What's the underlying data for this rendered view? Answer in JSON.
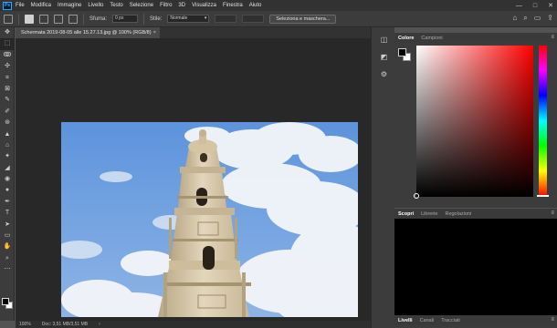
{
  "app": {
    "logo_text": "Ps"
  },
  "menu": [
    "File",
    "Modifica",
    "Immagine",
    "Livello",
    "Testo",
    "Selezione",
    "Filtro",
    "3D",
    "Visualizza",
    "Finestra",
    "Aiuto"
  ],
  "window_controls": [
    "—",
    "□",
    "✕"
  ],
  "options_bar": {
    "feather_label": "Sfuma:",
    "feather_value": "0 px",
    "style_label": "Stile:",
    "style_value": "Normale",
    "select_mask_button": "Seleziona e maschera...",
    "right_icons": [
      "⌂",
      "⌕",
      "▭",
      "⇪"
    ]
  },
  "tools": [
    "✥",
    "⬚",
    "ↂ",
    "✣",
    "⌗",
    "⊠",
    "✎",
    "✐",
    "⊛",
    "▲",
    "⌂",
    "✦",
    "◢",
    "◉",
    "●",
    "✒",
    "T",
    "➤",
    "▭",
    "✋",
    "⌕",
    "⋯"
  ],
  "document": {
    "tab_title": "Schermata 2019-08-05 alle 15.27.13.jpg @ 100% (RGB/8)",
    "tab_close": "×"
  },
  "status": {
    "zoom": "100%",
    "doc_info": "Doc: 3,51 MB/3,51 MB",
    "arrow": "›"
  },
  "dock_icons": [
    "◫",
    "◩",
    "⚙"
  ],
  "color_panel": {
    "tabs": [
      "Colore",
      "Campioni"
    ],
    "active_tab": 0,
    "menu": "≡"
  },
  "adjust_panel": {
    "tabs": [
      "Scopri",
      "Librerie",
      "Regolazioni"
    ],
    "active_tab": 0,
    "menu": "≡"
  },
  "layers_panel": {
    "tabs": [
      "Livelli",
      "Canali",
      "Tracciati"
    ],
    "active_tab": 0,
    "menu": "≡"
  },
  "colors": {
    "menubar": "#323232",
    "panel": "#3c3c3c",
    "canvas_bg": "#282828",
    "sky": "#6a9be0",
    "stone": "#d8c8a8"
  }
}
